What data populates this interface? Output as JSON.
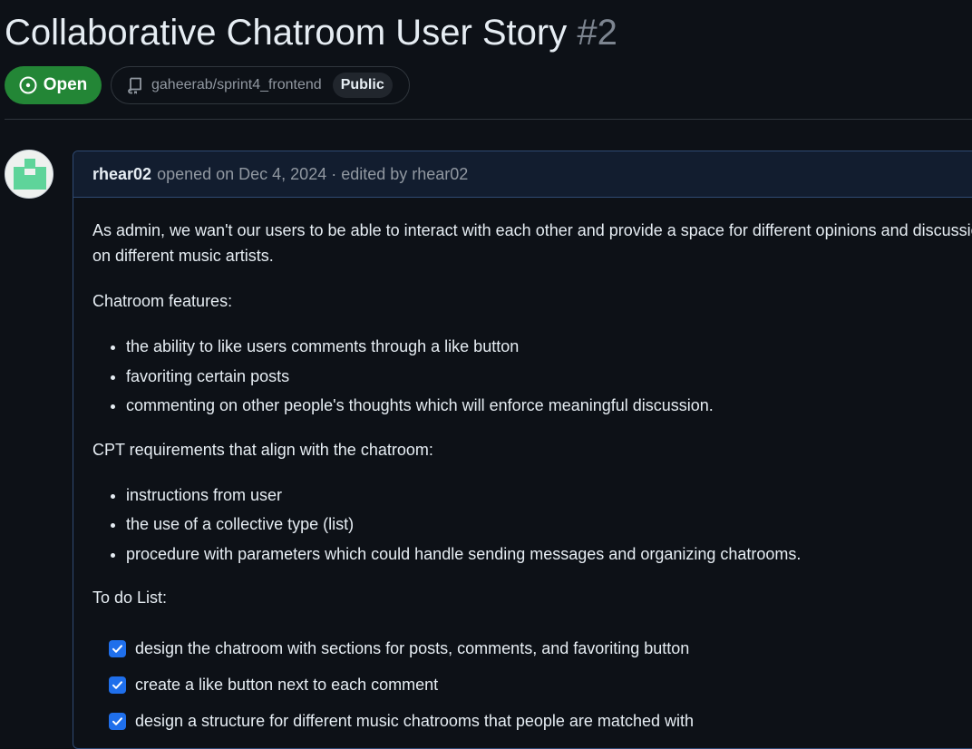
{
  "issue": {
    "title": "Collaborative Chatroom User Story",
    "number": "#2",
    "state": "Open",
    "repo": "gaheerab/sprint4_frontend",
    "visibility": "Public"
  },
  "comment": {
    "author": "rhear02",
    "meta": "opened on Dec 4, 2024 · edited by rhear02",
    "description": "As admin, we wan't our users to be able to interact with each other and provide a space for different opinions and discussion on different music artists.",
    "features_heading": "Chatroom features:",
    "features": [
      "the ability to like users comments through a like button",
      "favoriting certain posts",
      "commenting on other people's thoughts which will enforce meaningful discussion."
    ],
    "cpt_heading": "CPT requirements that align with the chatroom:",
    "cpt": [
      "instructions from user",
      "the use of a collective type (list)",
      "procedure with parameters which could handle sending messages and organizing chatrooms."
    ],
    "todo_heading": "To do List:",
    "todos": [
      {
        "label": "design the chatroom with sections for posts, comments, and favoriting button",
        "checked": true
      },
      {
        "label": "create a like button next to each comment",
        "checked": true
      },
      {
        "label": "design a structure for different music chatrooms that people are matched with",
        "checked": true
      }
    ]
  },
  "icons": {
    "state": "issue-opened-icon",
    "repo": "repo-icon",
    "check": "check-icon"
  },
  "colors": {
    "background": "#0d1117",
    "open_green": "#238636",
    "checkbox_blue": "#1f6feb",
    "avatar_green": "#5ed49a"
  }
}
